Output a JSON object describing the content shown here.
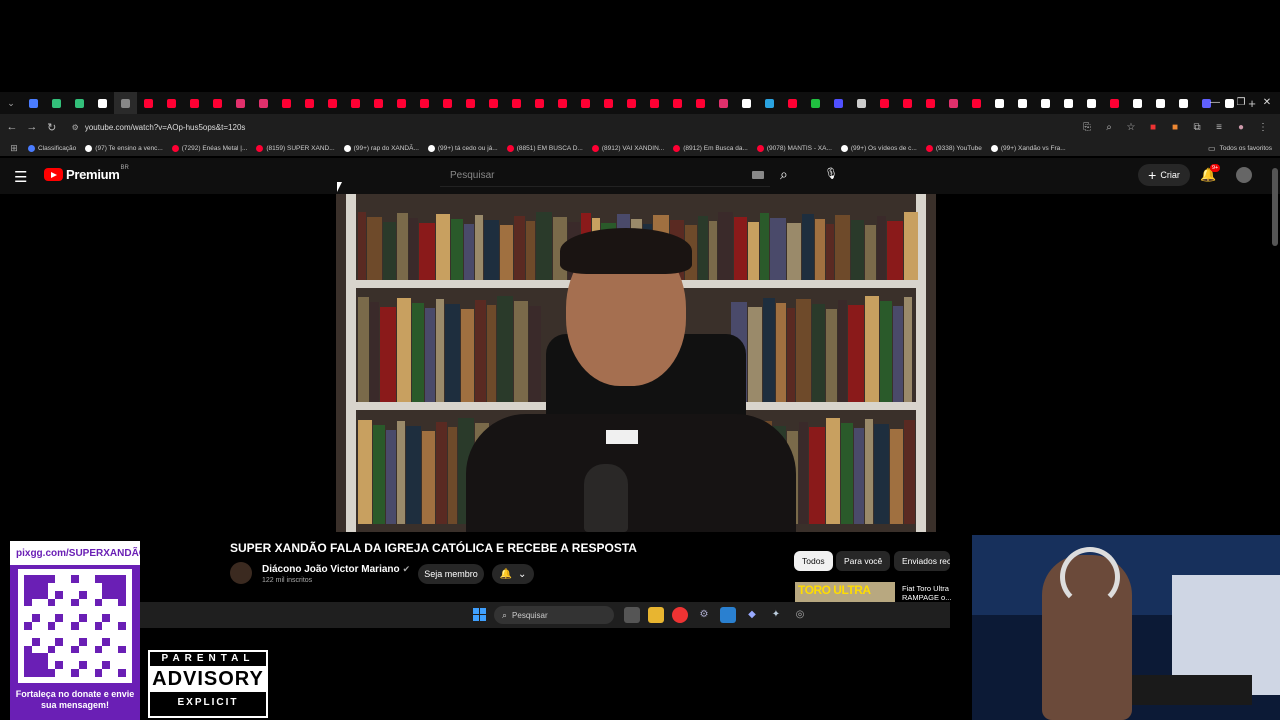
{
  "browser": {
    "url": "youtube.com/watch?v=AOp-hus5ops&t=120s",
    "tab_favicon_colors": [
      "#4a7cff",
      "#33c07a",
      "#33c07a",
      "#ffffff",
      "#888888",
      "#ff0033",
      "#ff0033",
      "#ff0033",
      "#ff0033",
      "#e1306c",
      "#e1306c",
      "#ff0033",
      "#ff0033",
      "#ff0033",
      "#ff0033",
      "#ff0033",
      "#ff0033",
      "#ff0033",
      "#ff0033",
      "#ff0033",
      "#ff0033",
      "#ff0033",
      "#ff0033",
      "#ff0033",
      "#ff0033",
      "#ff0033",
      "#ff0033",
      "#ff0033",
      "#ff0033",
      "#ff0033",
      "#e1306c",
      "#ffffff",
      "#2aa3e0",
      "#ff0033",
      "#20c040",
      "#5050ff",
      "#cccccc",
      "#ff0033",
      "#ff0033",
      "#ff0033",
      "#e1306c",
      "#ff0033",
      "#ffffff",
      "#ffffff",
      "#ffffff",
      "#ffffff",
      "#ffffff",
      "#ff0033",
      "#ffffff",
      "#ffffff",
      "#ffffff",
      "#6060ff",
      "#ffffff"
    ],
    "bookmarks": [
      {
        "label": "Classificação",
        "color": "#4a7cff"
      },
      {
        "label": "(97) Te ensino a venc...",
        "color": "#ffffff"
      },
      {
        "label": "(7292) Enéas Metal |...",
        "color": "#ff0033"
      },
      {
        "label": "(8159) SUPER XAND...",
        "color": "#ff0033"
      },
      {
        "label": "(99+) rap do XANDÃ...",
        "color": "#ffffff"
      },
      {
        "label": "(99+) tá cedo ou já...",
        "color": "#ffffff"
      },
      {
        "label": "(8851) EM BUSCA D...",
        "color": "#ff0033"
      },
      {
        "label": "(8912) VAI XANDIN...",
        "color": "#ff0033"
      },
      {
        "label": "(8912) Em Busca da...",
        "color": "#ff0033"
      },
      {
        "label": "(9078) MANTIS - XA...",
        "color": "#ff0033"
      },
      {
        "label": "(99+) Os vídeos de c...",
        "color": "#ffffff"
      },
      {
        "label": "(9338) YouTube",
        "color": "#ff0033"
      },
      {
        "label": "(99+) Xandão vs Fra...",
        "color": "#ffffff"
      }
    ],
    "bookmarks_all": "Todos os favoritos"
  },
  "youtube": {
    "logo_text": "Premium",
    "country": "BR",
    "search_placeholder": "Pesquisar",
    "create_label": "Criar",
    "notifications_badge": "9+"
  },
  "video": {
    "title": "SUPER XANDÃO FALA DA IGREJA CATÓLICA E RECEBE A RESPOSTA",
    "channel": "Diácono João Victor Mariano",
    "subscribers": "122 mil inscritos",
    "member_label": "Seja membro"
  },
  "chips": [
    "Todos",
    "Para você",
    "Enviados rec"
  ],
  "recommended": {
    "thumb_text": "TORO ULTRA",
    "title": "Fiat Toro Ultra RAMPAGE o..."
  },
  "taskbar": {
    "search_placeholder": "Pesquisar"
  },
  "overlays": {
    "donate_url": "pixgg.com/SUPERXANDÃO",
    "donate_message": "Fortaleça no donate e envie sua mensagem!",
    "advisory_top": "PARENTAL",
    "advisory_mid": "ADVISORY",
    "advisory_bottom": "EXPLICIT CONTENT"
  }
}
